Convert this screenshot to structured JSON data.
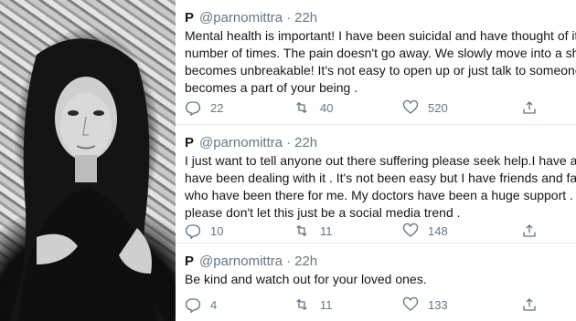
{
  "colors": {
    "muted": "#657786",
    "text": "#14171a",
    "divider": "#e6ecf0"
  },
  "photo": {
    "icon": "person-photo"
  },
  "tweets": [
    {
      "name": "P",
      "handle": "@parnomittra",
      "separator": "·",
      "time": "22h",
      "lines": [
        "Mental health is important! I have been suicidal and have thought of it",
        "number of times. The pain doesn't go away. We slowly move into a she",
        "becomes unbreakable! It's not easy to open up or just talk to someone.",
        "becomes a part of your being ."
      ],
      "replies": "22",
      "retweets": "40",
      "likes": "520"
    },
    {
      "name": "P",
      "handle": "@parnomittra",
      "separator": "·",
      "time": "22h",
      "lines": [
        "I just want to tell anyone out there suffering please seek help.I have and",
        "have been dealing with it . It's not been easy  but I have friends and fan",
        "who have been there for me. My doctors have been a huge support . So",
        "please don't let this just be a social media trend ."
      ],
      "replies": "10",
      "retweets": "11",
      "likes": "148"
    },
    {
      "name": "P",
      "handle": "@parnomittra",
      "separator": "·",
      "time": "22h",
      "lines": [
        "Be kind and watch out for your loved ones."
      ],
      "replies": "4",
      "retweets": "11",
      "likes": "133"
    }
  ]
}
